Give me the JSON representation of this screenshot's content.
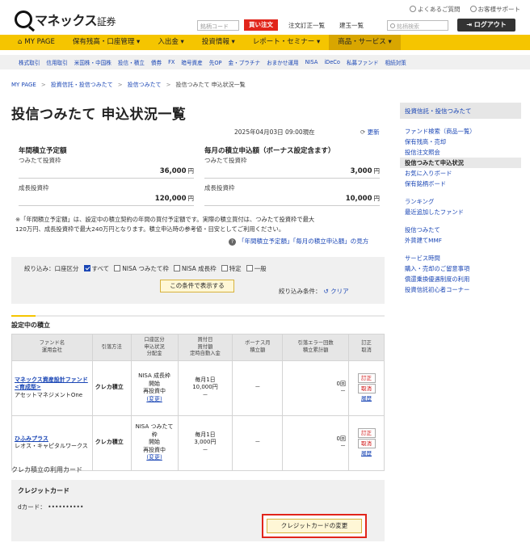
{
  "header": {
    "logo_main": "マネックス",
    "logo_sub": "証券",
    "faq": "よくあるご質問",
    "support": "お客様サポート",
    "brand_code_placeholder": "銘柄コード",
    "buy_order": "買い注文",
    "order_list": "注文訂正一覧",
    "holdings_list": "建玉一覧",
    "search_placeholder": "銘柄検索",
    "logout": "ログアウト"
  },
  "main_nav": [
    {
      "label": "MY PAGE"
    },
    {
      "label": "保有残高・口座管理 ▾"
    },
    {
      "label": "入出金 ▾"
    },
    {
      "label": "投資情報 ▾"
    },
    {
      "label": "レポート・セミナー ▾"
    },
    {
      "label": "商品・サービス ▾"
    }
  ],
  "sub_nav": [
    "株式取引",
    "信用取引",
    "米国株・中国株",
    "投信・積立",
    "債券",
    "FX",
    "暗号資産",
    "先OP",
    "金・プラチナ",
    "おまかせ運用",
    "NISA",
    "iDeCo",
    "私募ファンド",
    "相続対策"
  ],
  "breadcrumb": [
    "MY PAGE",
    "投資信託・投信つみたて",
    "投信つみたて",
    "投信つみたて 申込状況一覧"
  ],
  "page_title": "投信つみたて 申込状況一覧",
  "timestamp": "2025年04月03日 09:00現在",
  "refresh": "更新",
  "annual": {
    "title": "年間積立予定額",
    "tsumitate_label": "つみたて投資枠",
    "tsumitate_amount": "36,000",
    "growth_label": "成長投資枠",
    "growth_amount": "120,000",
    "yen": "円"
  },
  "monthly": {
    "title": "毎月の積立申込額（ボーナス設定含ます）",
    "tsumitate_label": "つみたて投資枠",
    "tsumitate_amount": "3,000",
    "growth_label": "成長投資枠",
    "growth_amount": "10,000",
    "yen": "円"
  },
  "note_line1": "※「年間積立予定額」は、設定中の積立契約の年間の買付予定額です。実際の積立買付は、つみたて投資枠で最大",
  "note_line2": "120万円、成長投資枠で最大240万円となります。積立申込時の参考値・目安としてご利用ください。",
  "help_link": "「年間積立予定額」「毎月の積立申込額」の見方",
  "filter": {
    "label": "絞り込み：口座区分",
    "options": [
      "すべて",
      "NISA つみたて枠",
      "NISA 成長枠",
      "特定",
      "一般"
    ],
    "button": "この条件で表示する",
    "cond_label": "絞り込み条件：",
    "clear": "クリア"
  },
  "section_title": "設定中の積立",
  "table": {
    "headers": [
      "ファンド名\n運用会社",
      "引落方法",
      "口座区分\n申込状況\n分配金",
      "買付日\n買付額\n定時自動入金",
      "ボーナス月\n積立額",
      "引落エラー回数\n積立累計額",
      "訂正\n取消"
    ],
    "rows": [
      {
        "fund": "マネックス資産設計ファンド<育成型>",
        "company": "アセットマネジメントOne",
        "method": "クレカ積立",
        "acct": "NISA 成長枠",
        "status": "開始",
        "dist": "再投資中",
        "change": "(変更)",
        "day": "毎月1日",
        "amount": "10,000円",
        "auto": "－",
        "bonus": "－",
        "errors": "0回",
        "total": "－",
        "edit": "訂正",
        "cancel": "取消",
        "history": "履歴"
      },
      {
        "fund": "ひふみプラス",
        "company": "レオス・キャピタルワークス",
        "method": "クレカ積立",
        "acct": "NISA つみたて枠",
        "status": "開始",
        "dist": "再投資中",
        "change": "(変更)",
        "day": "毎月1日",
        "amount": "3,000円",
        "auto": "－",
        "bonus": "－",
        "errors": "0回",
        "total": "－",
        "edit": "訂正",
        "cancel": "取消",
        "history": "履歴"
      }
    ]
  },
  "card_section_label": "クレカ積立の利用カード",
  "card_title": "クレジットカード",
  "card_number": "dカード：  ••••••••••",
  "card_change_button": "クレジットカードの変更",
  "sidebar": {
    "head": "投資信託・投信つみたて",
    "groups": [
      [
        "ファンド検索（商品一覧）",
        "保有残高・売却",
        "投信注文照会",
        "投信つみたて申込状況",
        "お気に入りボード",
        "保有銘柄ボード"
      ],
      [
        "ランキング",
        "最近追加したファンド"
      ],
      [
        "投信つみたて",
        "外貨建てMMF"
      ],
      [
        "サービス時間",
        "購入・売却のご留意事項",
        "償還乗換優遇制度の利用",
        "投資信託初心者コーナー"
      ]
    ],
    "current": "投信つみたて申込状況"
  }
}
